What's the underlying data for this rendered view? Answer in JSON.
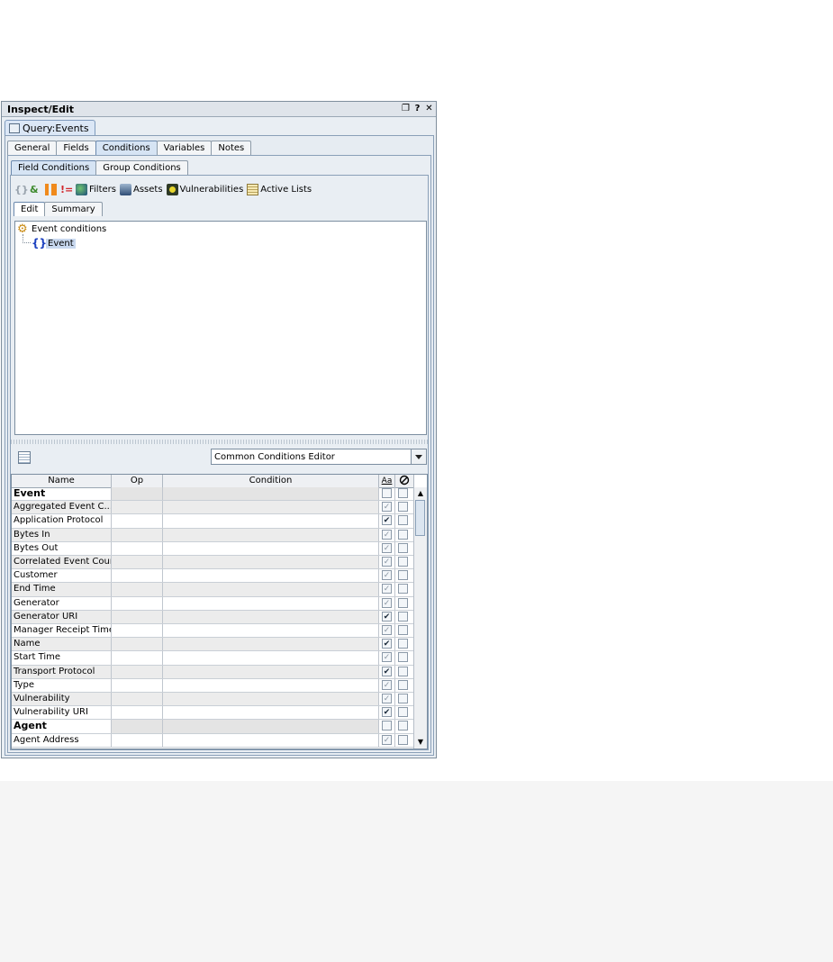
{
  "window": {
    "title": "Inspect/Edit"
  },
  "doc_tab": {
    "label": "Query:Events"
  },
  "main_tabs": [
    "General",
    "Fields",
    "Conditions",
    "Variables",
    "Notes"
  ],
  "sub_tabs": [
    "Field Conditions",
    "Group Conditions"
  ],
  "toolbar": {
    "filters": "Filters",
    "assets": "Assets",
    "vulnerabilities": "Vulnerabilities",
    "active_lists": "Active Lists"
  },
  "edit_tabs": [
    "Edit",
    "Summary"
  ],
  "tree": {
    "root": "Event conditions",
    "child": "Event"
  },
  "editor_select": {
    "value": "Common Conditions Editor"
  },
  "grid": {
    "headers": {
      "name": "Name",
      "op": "Op",
      "condition": "Condition",
      "case": "Aa"
    },
    "rows": [
      {
        "name": "Event",
        "group": true,
        "cb1": "",
        "cb2": ""
      },
      {
        "name": "Aggregated Event C...",
        "cb1": "✓",
        "cb2": "",
        "dim": true
      },
      {
        "name": "Application Protocol",
        "cb1": "✔",
        "cb2": ""
      },
      {
        "name": "Bytes In",
        "cb1": "✓",
        "cb2": "",
        "dim": true
      },
      {
        "name": "Bytes Out",
        "cb1": "✓",
        "cb2": "",
        "dim": true
      },
      {
        "name": "Correlated Event Count",
        "cb1": "✓",
        "cb2": "",
        "dim": true
      },
      {
        "name": "Customer",
        "cb1": "✓",
        "cb2": "",
        "dim": true
      },
      {
        "name": "End Time",
        "cb1": "✓",
        "cb2": "",
        "dim": true
      },
      {
        "name": "Generator",
        "cb1": "✓",
        "cb2": "",
        "dim": true
      },
      {
        "name": "Generator URI",
        "cb1": "✔",
        "cb2": ""
      },
      {
        "name": "Manager Receipt Time",
        "cb1": "✓",
        "cb2": "",
        "dim": true
      },
      {
        "name": "Name",
        "cb1": "✔",
        "cb2": ""
      },
      {
        "name": "Start Time",
        "cb1": "✓",
        "cb2": "",
        "dim": true
      },
      {
        "name": "Transport Protocol",
        "cb1": "✔",
        "cb2": ""
      },
      {
        "name": "Type",
        "cb1": "✓",
        "cb2": "",
        "dim": true
      },
      {
        "name": "Vulnerability",
        "cb1": "✓",
        "cb2": "",
        "dim": true
      },
      {
        "name": "Vulnerability URI",
        "cb1": "✔",
        "cb2": ""
      },
      {
        "name": "Agent",
        "group": true,
        "cb1": "",
        "cb2": ""
      },
      {
        "name": "Agent Address",
        "cb1": "✓",
        "cb2": "",
        "dim": true
      }
    ]
  }
}
